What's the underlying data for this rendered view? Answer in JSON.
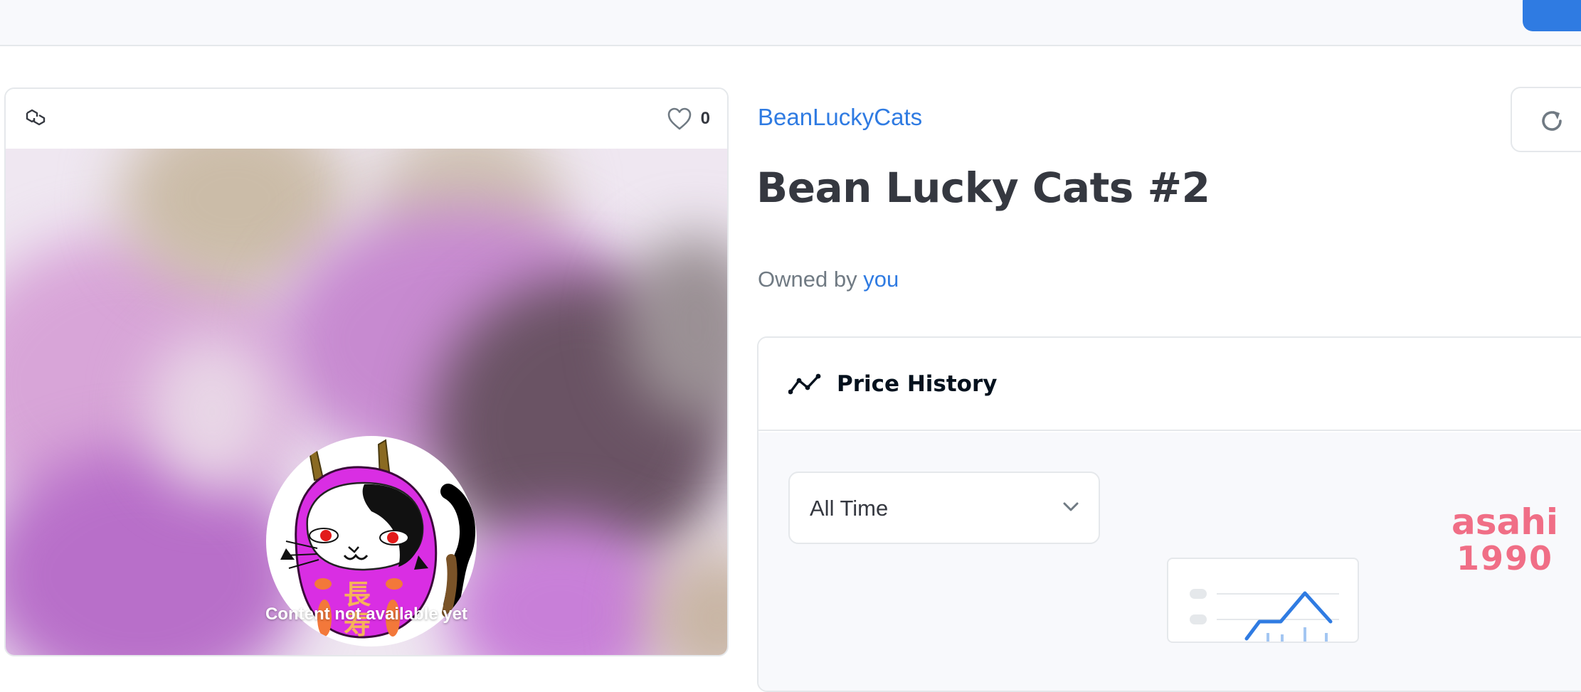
{
  "item": {
    "favorites_count": "0",
    "media_message": "Content not available yet",
    "collection_name": "BeanLuckyCats",
    "title": "Bean Lucky Cats #2",
    "owned_by_label": "Owned by",
    "owner": "you"
  },
  "price_history": {
    "title": "Price History",
    "period_selected": "All Time"
  },
  "watermark": {
    "line1": "asahi",
    "line2": "1990"
  },
  "colors": {
    "accent": "#2f7be2",
    "title_text": "#353840",
    "muted_text": "#707a83",
    "border": "#e5e8eb",
    "watermark": "#f06e86",
    "daruma_magenta": "#d92ee3"
  },
  "icons": {
    "chain": "polygon-chain-icon",
    "favorite": "heart-icon",
    "refresh": "refresh-icon",
    "price_history": "trend-line-icon",
    "select": "chevron-down-icon"
  }
}
